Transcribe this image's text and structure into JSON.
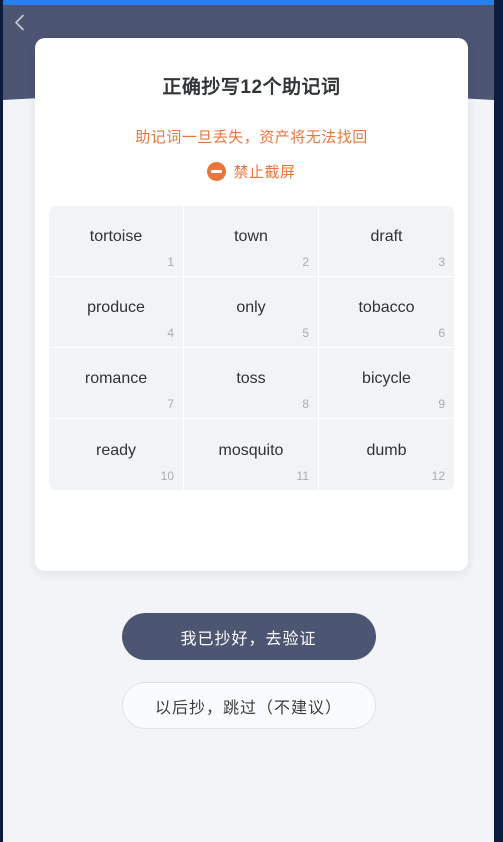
{
  "window": {
    "status_strip_color": "#2680eb",
    "header_color": "#4c5572",
    "page_background": "#f2f4f7",
    "edge_color": "#0d1b3e"
  },
  "header": {
    "back_icon": "chevron-left-icon"
  },
  "card": {
    "title": "正确抄写12个助记词",
    "warning": "助记词一旦丢失，资产将无法找回",
    "no_screenshot": {
      "icon": "prohibition-icon",
      "label": "禁止截屏",
      "color": "#e8763a"
    }
  },
  "mnemonic": {
    "count": 12,
    "words": [
      {
        "index": "1",
        "word": "tortoise"
      },
      {
        "index": "2",
        "word": "town"
      },
      {
        "index": "3",
        "word": "draft"
      },
      {
        "index": "4",
        "word": "produce"
      },
      {
        "index": "5",
        "word": "only"
      },
      {
        "index": "6",
        "word": "tobacco"
      },
      {
        "index": "7",
        "word": "romance"
      },
      {
        "index": "8",
        "word": "toss"
      },
      {
        "index": "9",
        "word": "bicycle"
      },
      {
        "index": "10",
        "word": "ready"
      },
      {
        "index": "11",
        "word": "mosquito"
      },
      {
        "index": "12",
        "word": "dumb"
      }
    ]
  },
  "actions": {
    "primary_label": "我已抄好，去验证",
    "secondary_label": "以后抄，跳过（不建议）",
    "primary_color": "#4c5572"
  }
}
